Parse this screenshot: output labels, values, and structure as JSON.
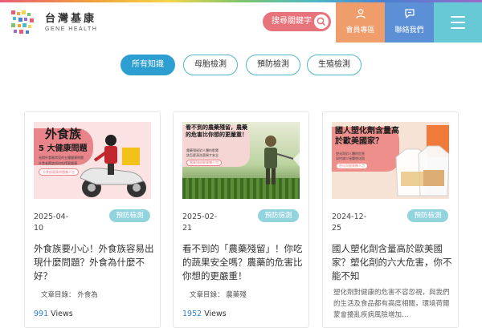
{
  "brand": {
    "name_cn": "台灣基康",
    "name_en": "GENE HEALTH"
  },
  "search": {
    "label": "搜尋關鍵字"
  },
  "nav": {
    "member": "會員專區",
    "contact": "聯絡我們"
  },
  "filters": [
    {
      "label": "所有知識",
      "active": true
    },
    {
      "label": "母胎檢測",
      "active": false
    },
    {
      "label": "預防檢測",
      "active": false
    },
    {
      "label": "生殖檢測",
      "active": false
    }
  ],
  "cards": [
    {
      "date": "2025-04-10",
      "date_line1": "2025-04-",
      "date_line2": "10",
      "tag": "預防檢測",
      "title": "外食族要小心！外食族容易出現什麼問題？外食為什麼不好？",
      "category": "文章目錄： 外食為",
      "views_num": "991",
      "views_label": "Views",
      "image": {
        "headline": "外食族",
        "sub": "5 大健康問題",
        "line1": "長期外食最常見的五種健康問題",
        "line2": "外食者應該如何吃得更健康",
        "pill": "外食族健康問題懶人包"
      }
    },
    {
      "date": "2025-02-21",
      "date_line1": "2025-02-",
      "date_line2": "21",
      "tag": "預防檢測",
      "title": "看不到的「農藥殘留」！你吃的蔬果安全嗎？農藥的危害比你想的更嚴重！",
      "category": "文章目錄： 農藥殘",
      "views_num": "1952",
      "views_label": "Views",
      "image": {
        "headline": "看不到的農藥殘留，農藥的危害比你想的更嚴重！",
        "line1": "農藥殘留對人體的影響",
        "line2": "該怎麼清洗蔬果才安全",
        "pill": "農藥殘留健康懶人包"
      }
    },
    {
      "date": "2024-12-25",
      "date_line1": "2024-12-",
      "date_line2": "25",
      "tag": "預防檢測",
      "title": "國人塑化劑含量高於歐美國家？塑化劑的六大危害，你不能不知",
      "excerpt": "塑化劑對健康的危害不容忽視，與我們的生活及食品都有高度相關，環境荷爾蒙會擾亂疾病風險增加…",
      "views_num": "",
      "views_label": "",
      "image": {
        "headline": "國人塑化劑含量高於歐美國家？",
        "line1": "塑化劑對人體的危害",
        "line2": "如何減少接觸塑化劑",
        "pill": "塑化劑健康懶人包"
      }
    }
  ],
  "colors": {
    "accent": "#2d9ed0",
    "tag": "#92d4de",
    "search": "#e8747b",
    "member": "#f09d6c",
    "contact": "#5b8fd6",
    "menu": "#67c9d6",
    "views": "#2d7fc6"
  },
  "icons": {
    "search": "search-icon",
    "member": "user-icon",
    "contact": "chat-icon",
    "menu": "hamburger-icon"
  }
}
